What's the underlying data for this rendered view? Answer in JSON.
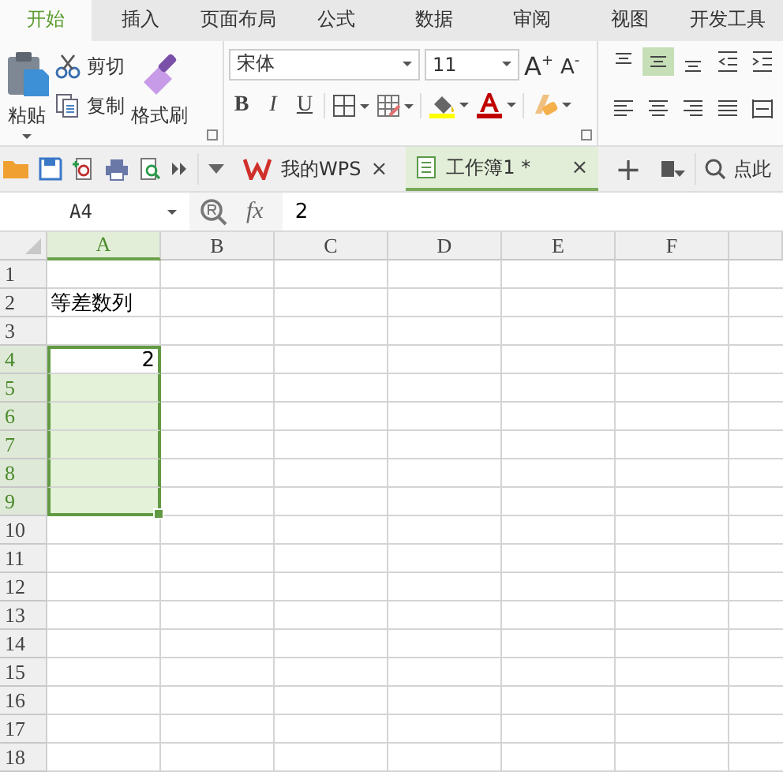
{
  "menu_tabs": [
    {
      "label": "开始",
      "selected": true
    },
    {
      "label": "插入",
      "selected": false
    },
    {
      "label": "页面布局",
      "selected": false
    },
    {
      "label": "公式",
      "selected": false
    },
    {
      "label": "数据",
      "selected": false
    },
    {
      "label": "审阅",
      "selected": false
    },
    {
      "label": "视图",
      "selected": false
    },
    {
      "label": "开发工具",
      "selected": false
    }
  ],
  "clipboard": {
    "paste": "粘贴",
    "cut": "剪切",
    "copy": "复制",
    "format_painter": "格式刷"
  },
  "font": {
    "name": "宋体",
    "size": "11",
    "grow": "A$^{+}$",
    "shrink": "A$^{-}$",
    "bold": "B",
    "italic": "I",
    "underline": "U"
  },
  "alignment": [
    {
      "kind": "top",
      "selected": false
    },
    {
      "kind": "middle",
      "selected": true
    },
    {
      "kind": "bottom",
      "selected": false
    },
    {
      "kind": "outdent",
      "selected": false
    },
    {
      "kind": "indent",
      "selected": false
    },
    {
      "kind": "left",
      "selected": false
    },
    {
      "kind": "center",
      "selected": false
    },
    {
      "kind": "right",
      "selected": false
    },
    {
      "kind": "justify",
      "selected": false
    },
    {
      "kind": "distributed",
      "selected": false
    }
  ],
  "doc_tabs": [
    {
      "label": "我的WPS",
      "kind": "home",
      "close": "×",
      "selected": false
    },
    {
      "label": "工作簿1 *",
      "kind": "workbook",
      "close": "×",
      "selected": true
    }
  ],
  "new_tab": "+",
  "search": {
    "placeholder": "点此"
  },
  "formula_bar": {
    "name_box": "A4",
    "fx": "fx",
    "value": "2"
  },
  "sheet": {
    "columns": [
      {
        "label": "A",
        "selected": true
      },
      {
        "label": "B",
        "selected": false
      },
      {
        "label": "C",
        "selected": false
      },
      {
        "label": "D",
        "selected": false
      },
      {
        "label": "E",
        "selected": false
      },
      {
        "label": "F",
        "selected": false
      }
    ],
    "rows": [
      {
        "label": "1",
        "selected": false
      },
      {
        "label": "2",
        "selected": false,
        "cells": [
          {
            "text": "等差数列",
            "kind": "text",
            "active": false
          }
        ]
      },
      {
        "label": "3",
        "selected": false
      },
      {
        "label": "4",
        "selected": true,
        "cells": [
          {
            "text": "2",
            "kind": "number",
            "active": true
          }
        ]
      },
      {
        "label": "5",
        "selected": true
      },
      {
        "label": "6",
        "selected": true
      },
      {
        "label": "7",
        "selected": true
      },
      {
        "label": "8",
        "selected": true
      },
      {
        "label": "9",
        "selected": true
      },
      {
        "label": "10",
        "selected": false
      },
      {
        "label": "11",
        "selected": false
      },
      {
        "label": "12",
        "selected": false
      },
      {
        "label": "13",
        "selected": false
      },
      {
        "label": "14",
        "selected": false
      },
      {
        "label": "15",
        "selected": false
      },
      {
        "label": "16",
        "selected": false
      },
      {
        "label": "17",
        "selected": false
      },
      {
        "label": "18",
        "selected": false
      }
    ]
  }
}
